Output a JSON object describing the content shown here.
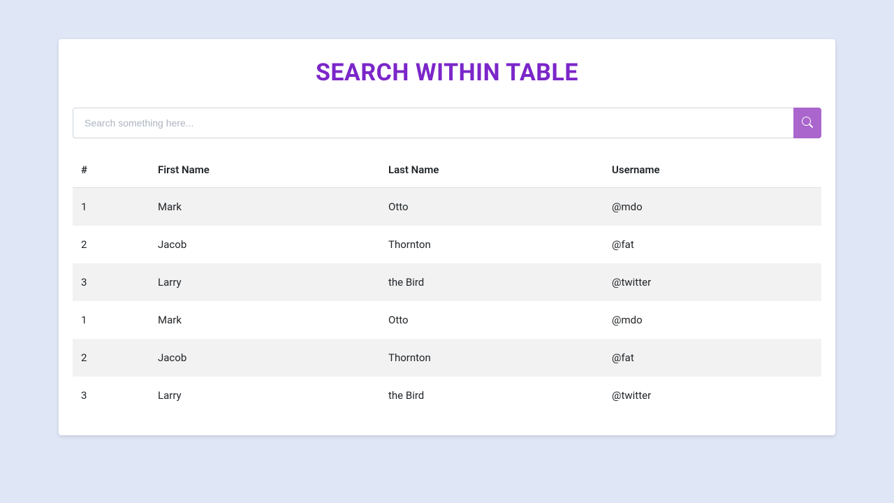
{
  "title": "SEARCH WITHIN TABLE",
  "search": {
    "placeholder": "Search something here...",
    "value": ""
  },
  "table": {
    "headers": {
      "idx": "#",
      "first": "First Name",
      "last": "Last Name",
      "user": "Username"
    },
    "rows": [
      {
        "idx": "1",
        "first": "Mark",
        "last": "Otto",
        "user": "@mdo"
      },
      {
        "idx": "2",
        "first": "Jacob",
        "last": "Thornton",
        "user": "@fat"
      },
      {
        "idx": "3",
        "first": "Larry",
        "last": "the Bird",
        "user": "@twitter"
      },
      {
        "idx": "1",
        "first": "Mark",
        "last": "Otto",
        "user": "@mdo"
      },
      {
        "idx": "2",
        "first": "Jacob",
        "last": "Thornton",
        "user": "@fat"
      },
      {
        "idx": "3",
        "first": "Larry",
        "last": "the Bird",
        "user": "@twitter"
      }
    ]
  },
  "colors": {
    "accent": "#7b26c9",
    "button": "#aa66cc",
    "page_bg": "#dfe6f6"
  }
}
